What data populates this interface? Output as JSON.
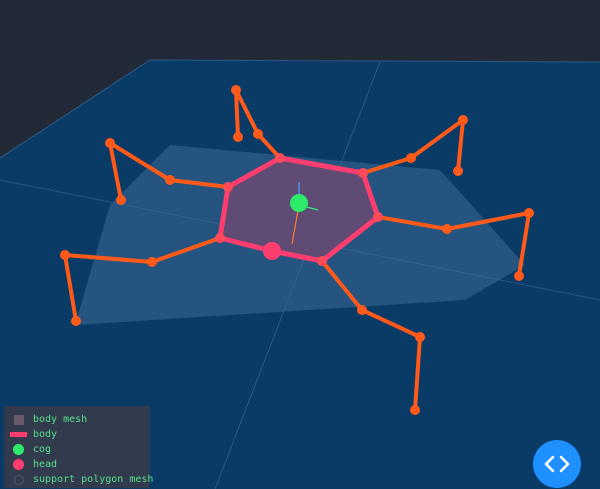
{
  "legend": [
    {
      "label": "body mesh",
      "swatch": "mesh"
    },
    {
      "label": "body",
      "swatch": "body"
    },
    {
      "label": "cog",
      "swatch": "cog"
    },
    {
      "label": "head",
      "swatch": "head"
    },
    {
      "label": "support polygon mesh",
      "swatch": "support"
    }
  ],
  "colors": {
    "background": "#222a38",
    "ground": "#0a3a66",
    "body": "#ff3d6e",
    "legs": "#ff5a1a",
    "cog": "#2eea6a",
    "head": "#ff3d6e",
    "legend_text": "#55e08a",
    "button": "#1e90ff"
  },
  "icons": {
    "code_button": "code-brackets-icon"
  }
}
